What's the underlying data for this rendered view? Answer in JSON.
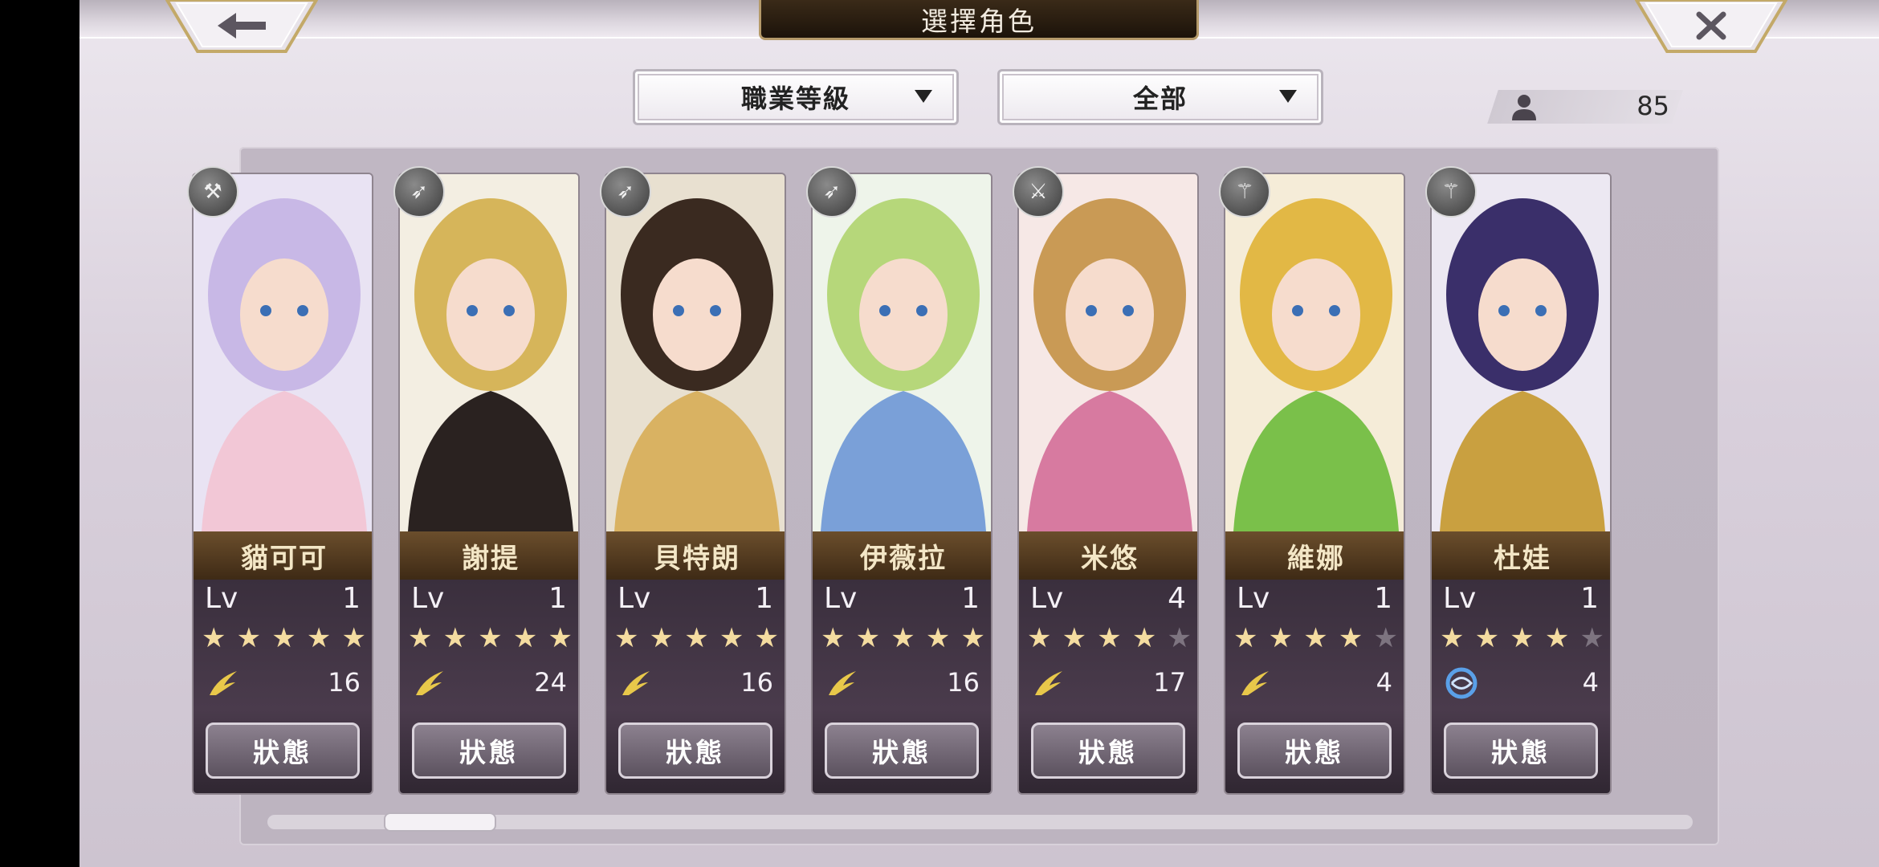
{
  "header": {
    "title": "選擇角色",
    "back_icon": "back-arrow-icon",
    "close_icon": "close-icon"
  },
  "filters": {
    "job": {
      "label": "職業等級"
    },
    "scope": {
      "label": "全部"
    }
  },
  "roster": {
    "count": "85"
  },
  "cards": [
    {
      "name": "貓可可",
      "lv_label": "Lv",
      "lv": "1",
      "stars": 5,
      "stars_max": 5,
      "element": "wind",
      "element_value": "16",
      "weapon": "axe-icon",
      "status": "狀態",
      "palette": [
        "#e9e3f3",
        "#c8b8e6",
        "#f2c7d6"
      ]
    },
    {
      "name": "謝提",
      "lv_label": "Lv",
      "lv": "1",
      "stars": 5,
      "stars_max": 5,
      "element": "wind",
      "element_value": "24",
      "weapon": "spear-icon",
      "status": "狀態",
      "palette": [
        "#f3eee2",
        "#d6b55a",
        "#2a2220"
      ]
    },
    {
      "name": "貝特朗",
      "lv_label": "Lv",
      "lv": "1",
      "stars": 5,
      "stars_max": 5,
      "element": "wind",
      "element_value": "16",
      "weapon": "spear-icon",
      "status": "狀態",
      "palette": [
        "#e8e0d0",
        "#3a2a20",
        "#d9b262"
      ]
    },
    {
      "name": "伊薇拉",
      "lv_label": "Lv",
      "lv": "1",
      "stars": 5,
      "stars_max": 5,
      "element": "wind",
      "element_value": "16",
      "weapon": "spear-icon",
      "status": "狀態",
      "palette": [
        "#eef4ea",
        "#b6d77a",
        "#7aa0d8"
      ]
    },
    {
      "name": "米悠",
      "lv_label": "Lv",
      "lv": "4",
      "stars": 4,
      "stars_max": 5,
      "element": "wind",
      "element_value": "17",
      "weapon": "sword-icon",
      "status": "狀態",
      "palette": [
        "#f6e8e6",
        "#c99a55",
        "#d77aa0"
      ]
    },
    {
      "name": "維娜",
      "lv_label": "Lv",
      "lv": "1",
      "stars": 4,
      "stars_max": 5,
      "element": "wind",
      "element_value": "4",
      "weapon": "staff-icon",
      "status": "狀態",
      "palette": [
        "#f5ecd8",
        "#e2b845",
        "#7ac04a"
      ]
    },
    {
      "name": "杜娃",
      "lv_label": "Lv",
      "lv": "1",
      "stars": 4,
      "stars_max": 5,
      "element": "water",
      "element_value": "4",
      "weapon": "staff-icon",
      "status": "狀態",
      "palette": [
        "#ece8f2",
        "#3a2f6a",
        "#c9a040"
      ]
    }
  ],
  "colors": {
    "wind": "#e8c84a",
    "water": "#5aa0e8"
  }
}
